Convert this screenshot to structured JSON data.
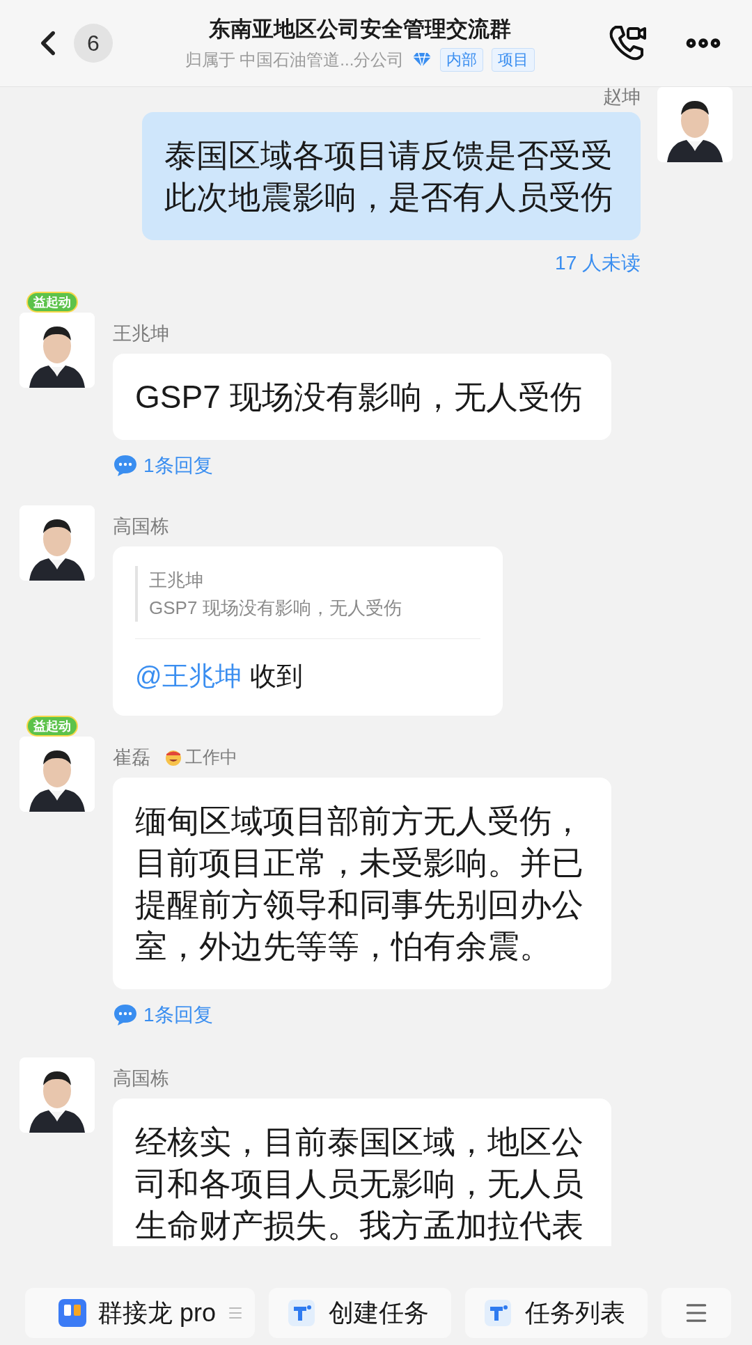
{
  "header": {
    "back_count": "6",
    "title": "东南亚地区公司安全管理交流群",
    "subtitle": "归属于 中国石油管道...分公司",
    "tags": [
      "内部",
      "项目"
    ]
  },
  "messages": [
    {
      "kind": "self",
      "sender": "赵坤",
      "text": "泰国区域各项目请反馈是否受受此次地震影响，是否有人员受伤",
      "unread": "17 人未读"
    },
    {
      "kind": "text",
      "sender": "王兆坤",
      "frame_badge": "益起动",
      "text": "GSP7 现场没有影响，无人受伤",
      "replies": "1条回复"
    },
    {
      "kind": "quote",
      "sender": "高国栋",
      "quote_sender": "王兆坤",
      "quote_text": "GSP7 现场没有影响，无人受伤",
      "mention": "@王兆坤",
      "text": "收到"
    },
    {
      "kind": "text",
      "sender": "崔磊",
      "frame_badge": "益起动",
      "status": "工作中",
      "text": "缅甸区域项目部前方无人受伤，目前项目正常，未受影响。并已提醒前方领导和同事先别回办公室，外边先等等，怕有余震。",
      "replies": "1条回复"
    },
    {
      "kind": "text",
      "sender": "高国栋",
      "text": "经核实，目前泰国区域，地区公司和各项目人员无影响，无人员生命财产损失。我方孟加拉代表"
    }
  ],
  "toolbar": [
    {
      "kind": "app",
      "label": "群接龙 pro"
    },
    {
      "kind": "task",
      "label": "创建任务"
    },
    {
      "kind": "task",
      "label": "任务列表"
    },
    {
      "kind": "menu"
    }
  ]
}
